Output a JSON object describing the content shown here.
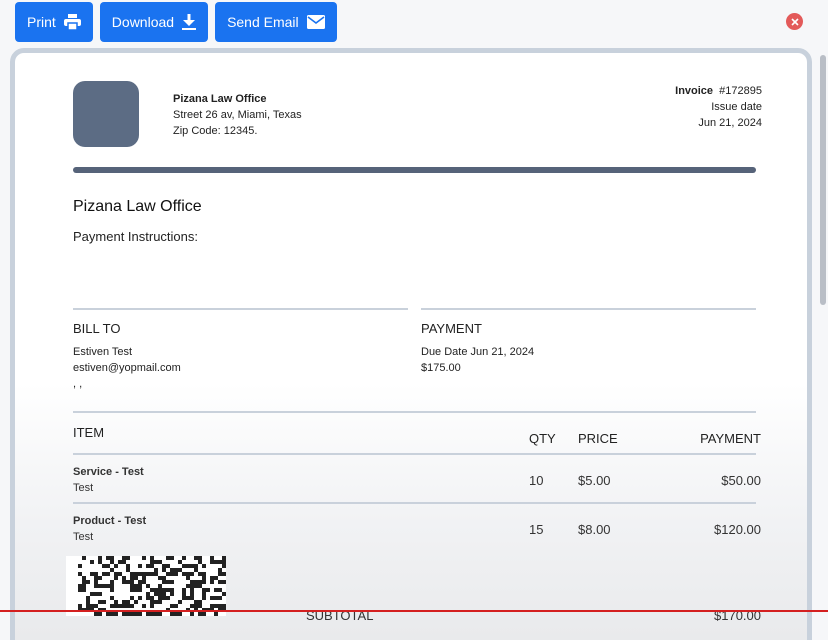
{
  "toolbar": {
    "print_label": "Print",
    "download_label": "Download",
    "send_email_label": "Send Email"
  },
  "colors": {
    "button_bg": "#1a73f0",
    "close_bg": "#e35a5a",
    "header_bar": "#566379",
    "logo_bg": "#5c6c84"
  },
  "invoice": {
    "company_name": "Pizana Law Office",
    "company_street": "Street 26 av, Miami, Texas",
    "company_zip": "Zip Code: 12345.",
    "invoice_label": "Invoice",
    "invoice_number": "#172895",
    "issue_date_label": "Issue date",
    "issue_date": "Jun 21, 2024",
    "title": "Pizana Law Office",
    "payment_instructions": "Payment Instructions:",
    "bill_to": {
      "heading": "BILL TO",
      "name": "Estiven Test",
      "email": "estiven@yopmail.com",
      "address": ", ,"
    },
    "payment": {
      "heading": "PAYMENT",
      "due_date": "Due Date Jun 21, 2024",
      "amount": "$175.00"
    },
    "table": {
      "headers": {
        "item": "ITEM",
        "qty": "QTY",
        "price": "PRICE",
        "payment": "PAYMENT"
      },
      "rows": [
        {
          "name": "Service - Test",
          "desc": "Test",
          "qty": "10",
          "price": "$5.00",
          "payment": "$50.00"
        },
        {
          "name": "Product - Test",
          "desc": "Test",
          "qty": "15",
          "price": "$8.00",
          "payment": "$120.00"
        }
      ]
    },
    "subtotal_label": "SUBTOTAL",
    "subtotal_value": "$170.00"
  }
}
